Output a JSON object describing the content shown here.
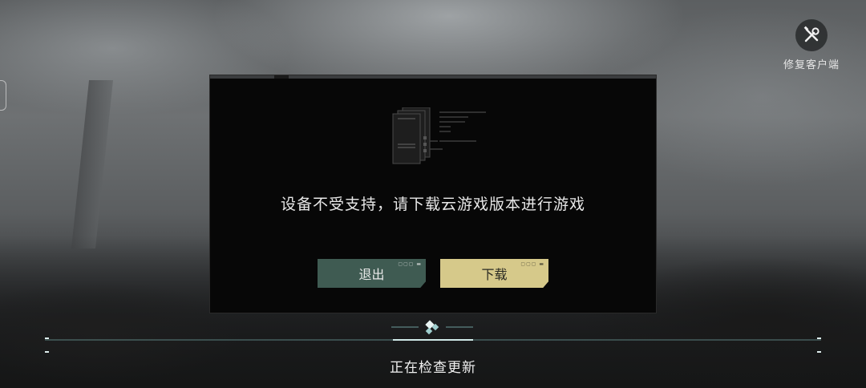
{
  "repair": {
    "label": "修复客户端",
    "icon": "wrench-screwdriver-icon"
  },
  "dialog": {
    "message": "设备不受支持，请下载云游戏版本进行游戏",
    "exit_label": "退出",
    "download_label": "下载",
    "button_deco": "▢▢▢ ▬"
  },
  "loading": {
    "status": "正在检查更新"
  },
  "colors": {
    "exit": "#3f5b52",
    "download": "#d6c98a",
    "progress_accent": "#8fd3cf"
  }
}
